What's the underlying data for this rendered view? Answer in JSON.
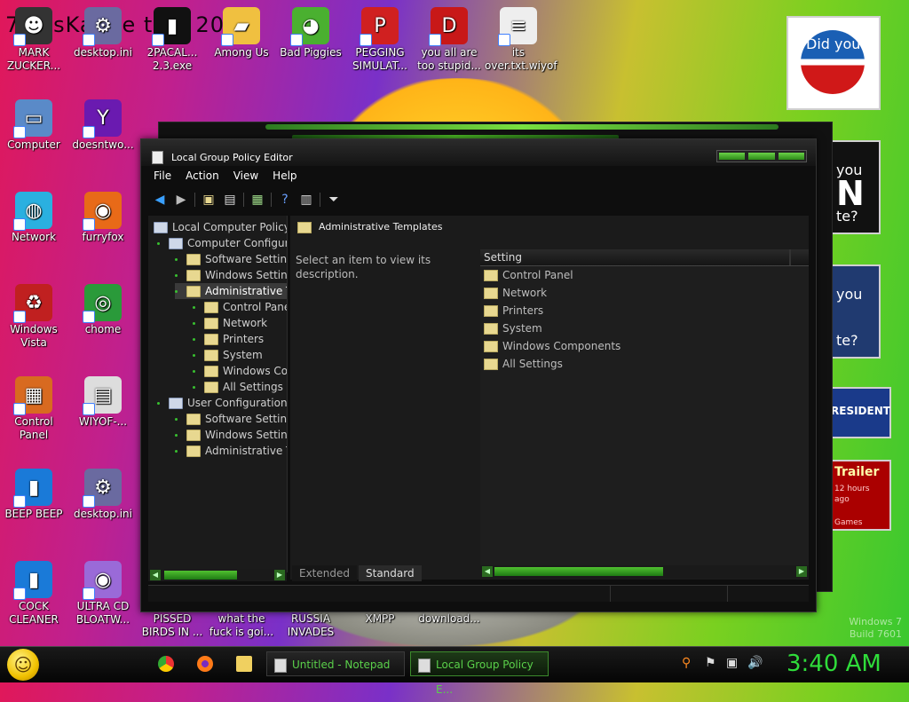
{
  "desktop": {
    "overlay_title": "7 ossKanae tion 2012",
    "icons": [
      {
        "label": "MARK ZUCKER...",
        "icon": "person-icon"
      },
      {
        "label": "desktop.ini",
        "icon": "settings-file-icon"
      },
      {
        "label": "2PACAL... 2.3.exe",
        "icon": "console-icon"
      },
      {
        "label": "Among Us",
        "icon": "folder-icon"
      },
      {
        "label": "Bad Piggies",
        "icon": "pig-icon"
      },
      {
        "label": "PEGGING SIMULAT...",
        "icon": "p-logo-icon"
      },
      {
        "label": "you all are too stupid...",
        "icon": "devcpp-icon"
      },
      {
        "label": "its over.txt.wiyof",
        "icon": "text-file-icon"
      },
      {
        "label": "Computer",
        "icon": "computer-icon"
      },
      {
        "label": "doesntwo...",
        "icon": "yahoo-icon"
      },
      {
        "label": "Network",
        "icon": "network-icon"
      },
      {
        "label": "furryfox",
        "icon": "firefox-icon"
      },
      {
        "label": "Windows Vista",
        "icon": "recycle-bin-icon"
      },
      {
        "label": "chome",
        "icon": "chrome-icon"
      },
      {
        "label": "Control Panel",
        "icon": "control-panel-icon"
      },
      {
        "label": "WIYOF-...",
        "icon": "document-icon"
      },
      {
        "label": "BEEP BEEP",
        "icon": "blue-app-icon"
      },
      {
        "label": "desktop.ini",
        "icon": "settings-file-icon"
      },
      {
        "label": "COCK CLEANER",
        "icon": "blue-app-icon"
      },
      {
        "label": "ULTRA CD BLOATW...",
        "icon": "cd-icon"
      },
      {
        "label": "PISSED BIRDS IN ...",
        "icon": "bird-icon"
      },
      {
        "label": "what the fuck is goi...",
        "icon": "file-icon"
      },
      {
        "label": "RUSSIA INVADES",
        "icon": "file-icon"
      },
      {
        "label": "XMPP",
        "icon": "file-icon"
      },
      {
        "label": "download...",
        "icon": "file-icon"
      }
    ],
    "ads": {
      "ad1": "Did you",
      "ad2a": "you",
      "ad2b": "N",
      "ad2c": "te?",
      "ad3a": "you",
      "ad3b": "te?",
      "ad4": "RESIDENT",
      "ad5a": "Trailer",
      "ad5b": "12 hours",
      "ad5c": "ago",
      "ad5d": "Games"
    },
    "build_text_1": "Windows 7",
    "build_text_2": "Build 7601"
  },
  "window": {
    "title": "Local Group Policy Editor",
    "menu": [
      "File",
      "Action",
      "View",
      "Help"
    ],
    "tree": [
      {
        "label": "Local Computer Policy",
        "level": 0
      },
      {
        "label": "Computer Configura",
        "level": 1
      },
      {
        "label": "Software Setting",
        "level": 2
      },
      {
        "label": "Windows Setting",
        "level": 2
      },
      {
        "label": "Administrative T",
        "level": 2,
        "selected": true
      },
      {
        "label": "Control Pane",
        "level": 3
      },
      {
        "label": "Network",
        "level": 3
      },
      {
        "label": "Printers",
        "level": 3
      },
      {
        "label": "System",
        "level": 3
      },
      {
        "label": "Windows Co",
        "level": 3
      },
      {
        "label": "All Settings",
        "level": 3
      },
      {
        "label": "User Configuration",
        "level": 1
      },
      {
        "label": "Software Setting",
        "level": 2
      },
      {
        "label": "Windows Setting",
        "level": 2
      },
      {
        "label": "Administrative T",
        "level": 2
      }
    ],
    "header": "Administrative Templates",
    "description": "Select an item to view its description.",
    "column": "Setting",
    "items": [
      "Control Panel",
      "Network",
      "Printers",
      "System",
      "Windows Components",
      "All Settings"
    ],
    "tabs": [
      "Extended",
      "Standard"
    ],
    "active_tab": "Standard"
  },
  "taskbar": {
    "tasks": [
      {
        "label": "Untitled - Notepad",
        "active": false
      },
      {
        "label": "Local Group Policy E...",
        "active": true
      }
    ],
    "clock": "3:40 AM",
    "accent": "#2fdc3a"
  }
}
